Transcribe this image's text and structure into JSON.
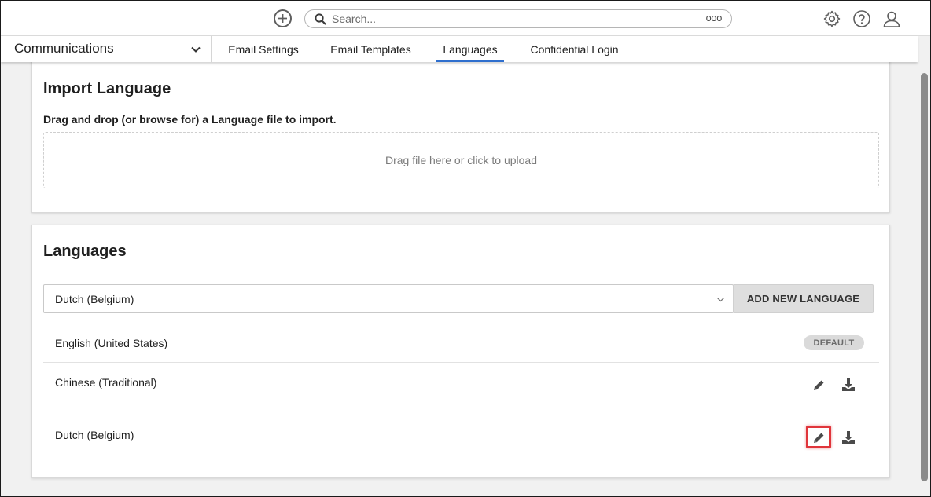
{
  "topbar": {
    "search_placeholder": "Search...",
    "more_label": "ooo",
    "icons": [
      "add-icon",
      "search-icon",
      "gear-icon",
      "help-icon",
      "user-icon"
    ]
  },
  "nav": {
    "module": "Communications",
    "tabs": [
      {
        "label": "Email Settings",
        "active": false
      },
      {
        "label": "Email Templates",
        "active": false
      },
      {
        "label": "Languages",
        "active": true
      },
      {
        "label": "Confidential Login",
        "active": false
      }
    ]
  },
  "import_card": {
    "title": "Import Language",
    "hint": "Drag and drop (or browse for) a Language file to import.",
    "dropzone_text": "Drag file here or click to upload"
  },
  "languages_card": {
    "title": "Languages",
    "selected_language": "Dutch (Belgium)",
    "add_button": "ADD NEW LANGUAGE",
    "rows": [
      {
        "name": "English (United States)",
        "badge": "DEFAULT"
      },
      {
        "name": "Chinese (Traditional)"
      },
      {
        "name": "Dutch (Belgium)",
        "highlighted_action": "edit"
      }
    ]
  },
  "colors": {
    "accent": "#2f6fce",
    "highlight": "#e0353b",
    "badge_bg": "#dadada"
  }
}
